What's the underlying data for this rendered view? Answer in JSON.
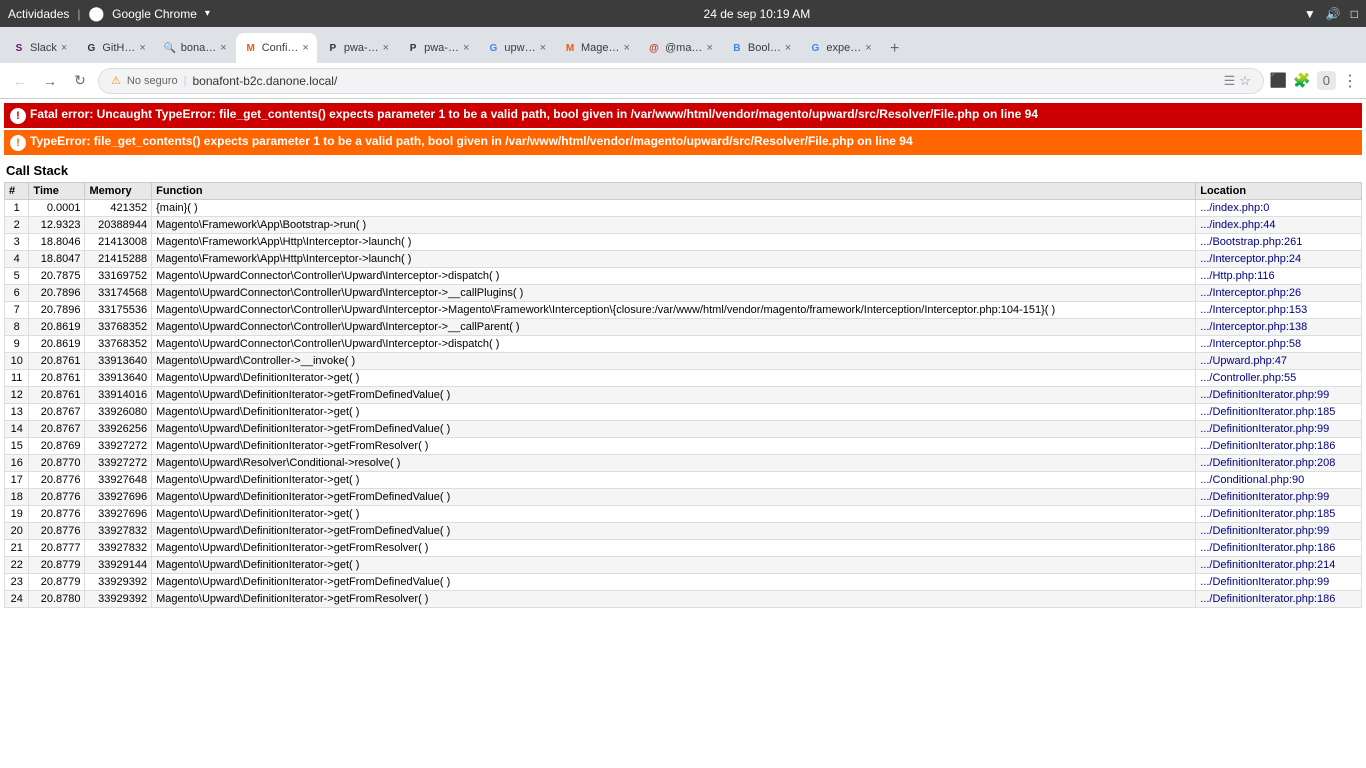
{
  "os": {
    "activities": "Actividades",
    "chrome_label": "Google Chrome",
    "datetime": "24 de sep  10:19 AM"
  },
  "tabs": [
    {
      "id": 1,
      "favicon": "S",
      "favicon_color": "#611f69",
      "label": "Slack",
      "active": false,
      "url": ""
    },
    {
      "id": 2,
      "favicon": "G",
      "favicon_color": "#333",
      "label": "GitH…",
      "active": false,
      "url": ""
    },
    {
      "id": 3,
      "favicon": "🔍",
      "favicon_color": "#4285f4",
      "label": "bona…",
      "active": false,
      "url": ""
    },
    {
      "id": 4,
      "favicon": "M",
      "favicon_color": "#e75d0d",
      "label": "Confi…",
      "active": true,
      "url": ""
    },
    {
      "id": 5,
      "favicon": "P",
      "favicon_color": "#333",
      "label": "pwa-…",
      "active": false,
      "url": ""
    },
    {
      "id": 6,
      "favicon": "P",
      "favicon_color": "#333",
      "label": "pwa-…",
      "active": false,
      "url": ""
    },
    {
      "id": 7,
      "favicon": "G",
      "favicon_color": "#4285f4",
      "label": "upw…",
      "active": false,
      "url": ""
    },
    {
      "id": 8,
      "favicon": "M",
      "favicon_color": "#e75d0d",
      "label": "Mage…",
      "active": false,
      "url": ""
    },
    {
      "id": 9,
      "favicon": "@",
      "favicon_color": "#c0392b",
      "label": "@ma…",
      "active": false,
      "url": ""
    },
    {
      "id": 10,
      "favicon": "B",
      "favicon_color": "#4285f4",
      "label": "Bool…",
      "active": false,
      "url": ""
    },
    {
      "id": 11,
      "favicon": "G",
      "favicon_color": "#4285f4",
      "label": "expe…",
      "active": false,
      "url": ""
    }
  ],
  "address_bar": {
    "security_label": "No seguro",
    "url": "bonafont-b2c.danone.local/"
  },
  "errors": {
    "fatal": {
      "icon": "!",
      "message": "Fatal error: Uncaught TypeError: file_get_contents() expects parameter 1 to be a valid path, bool given in /var/www/html/vendor/magento/upward/src/Resolver/File.php on line 94"
    },
    "type": {
      "icon": "!",
      "message": "TypeError: file_get_contents() expects parameter 1 to be a valid path, bool given in /var/www/html/vendor/magento/upward/src/Resolver/File.php on line 94"
    }
  },
  "callstack": {
    "title": "Call Stack",
    "columns": [
      "#",
      "Time",
      "Memory",
      "Function",
      "Location"
    ],
    "rows": [
      {
        "num": 1,
        "time": "0.0001",
        "memory": "421352",
        "func": "{main}( )",
        "location": ".../index.php:0"
      },
      {
        "num": 2,
        "time": "12.9323",
        "memory": "20388944",
        "func": "Magento\\Framework\\App\\Bootstrap->run( )",
        "location": ".../index.php:44"
      },
      {
        "num": 3,
        "time": "18.8046",
        "memory": "21413008",
        "func": "Magento\\Framework\\App\\Http\\Interceptor->launch( )",
        "location": ".../Bootstrap.php:261"
      },
      {
        "num": 4,
        "time": "18.8047",
        "memory": "21415288",
        "func": "Magento\\Framework\\App\\Http\\Interceptor->launch( )",
        "location": ".../Interceptor.php:24"
      },
      {
        "num": 5,
        "time": "20.7875",
        "memory": "33169752",
        "func": "Magento\\UpwardConnector\\Controller\\Upward\\Interceptor->dispatch( )",
        "location": ".../Http.php:116"
      },
      {
        "num": 6,
        "time": "20.7896",
        "memory": "33174568",
        "func": "Magento\\UpwardConnector\\Controller\\Upward\\Interceptor->__callPlugins( )",
        "location": ".../Interceptor.php:26"
      },
      {
        "num": 7,
        "time": "20.7896",
        "memory": "33175536",
        "func": "Magento\\UpwardConnector\\Controller\\Upward\\Interceptor->Magento\\Framework\\Interception\\{closure:/var/www/html/vendor/magento/framework/Interception/Interceptor.php:104-151}( )",
        "location": ".../Interceptor.php:153"
      },
      {
        "num": 8,
        "time": "20.8619",
        "memory": "33768352",
        "func": "Magento\\UpwardConnector\\Controller\\Upward\\Interceptor->__callParent( )",
        "location": ".../Interceptor.php:138"
      },
      {
        "num": 9,
        "time": "20.8619",
        "memory": "33768352",
        "func": "Magento\\UpwardConnector\\Controller\\Upward\\Interceptor->dispatch( )",
        "location": ".../Interceptor.php:58"
      },
      {
        "num": 10,
        "time": "20.8761",
        "memory": "33913640",
        "func": "Magento\\Upward\\Controller->__invoke( )",
        "location": ".../Upward.php:47"
      },
      {
        "num": 11,
        "time": "20.8761",
        "memory": "33913640",
        "func": "Magento\\Upward\\DefinitionIterator->get( )",
        "location": ".../Controller.php:55"
      },
      {
        "num": 12,
        "time": "20.8761",
        "memory": "33914016",
        "func": "Magento\\Upward\\DefinitionIterator->getFromDefinedValue( )",
        "location": ".../DefinitionIterator.php:99"
      },
      {
        "num": 13,
        "time": "20.8767",
        "memory": "33926080",
        "func": "Magento\\Upward\\DefinitionIterator->get( )",
        "location": ".../DefinitionIterator.php:185"
      },
      {
        "num": 14,
        "time": "20.8767",
        "memory": "33926256",
        "func": "Magento\\Upward\\DefinitionIterator->getFromDefinedValue( )",
        "location": ".../DefinitionIterator.php:99"
      },
      {
        "num": 15,
        "time": "20.8769",
        "memory": "33927272",
        "func": "Magento\\Upward\\DefinitionIterator->getFromResolver( )",
        "location": ".../DefinitionIterator.php:186"
      },
      {
        "num": 16,
        "time": "20.8770",
        "memory": "33927272",
        "func": "Magento\\Upward\\Resolver\\Conditional->resolve( )",
        "location": ".../DefinitionIterator.php:208"
      },
      {
        "num": 17,
        "time": "20.8776",
        "memory": "33927648",
        "func": "Magento\\Upward\\DefinitionIterator->get( )",
        "location": ".../Conditional.php:90"
      },
      {
        "num": 18,
        "time": "20.8776",
        "memory": "33927696",
        "func": "Magento\\Upward\\DefinitionIterator->getFromDefinedValue( )",
        "location": ".../DefinitionIterator.php:99"
      },
      {
        "num": 19,
        "time": "20.8776",
        "memory": "33927696",
        "func": "Magento\\Upward\\DefinitionIterator->get( )",
        "location": ".../DefinitionIterator.php:185"
      },
      {
        "num": 20,
        "time": "20.8776",
        "memory": "33927832",
        "func": "Magento\\Upward\\DefinitionIterator->getFromDefinedValue( )",
        "location": ".../DefinitionIterator.php:99"
      },
      {
        "num": 21,
        "time": "20.8777",
        "memory": "33927832",
        "func": "Magento\\Upward\\DefinitionIterator->getFromResolver( )",
        "location": ".../DefinitionIterator.php:186"
      },
      {
        "num": 22,
        "time": "20.8779",
        "memory": "33929144",
        "func": "Magento\\Upward\\DefinitionIterator->get( )",
        "location": ".../DefinitionIterator.php:214"
      },
      {
        "num": 23,
        "time": "20.8779",
        "memory": "33929392",
        "func": "Magento\\Upward\\DefinitionIterator->getFromDefinedValue( )",
        "location": ".../DefinitionIterator.php:99"
      },
      {
        "num": 24,
        "time": "20.8780",
        "memory": "33929392",
        "func": "Magento\\Upward\\DefinitionIterator->getFromResolver( )",
        "location": ".../DefinitionIterator.php:186"
      }
    ]
  }
}
